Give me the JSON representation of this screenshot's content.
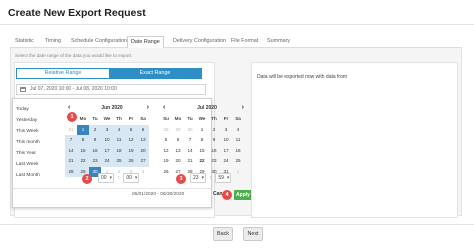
{
  "dialog": {
    "title": "Create New Export Request"
  },
  "tabs": [
    {
      "label": "Statistic"
    },
    {
      "label": "Timing"
    },
    {
      "label": "Schedule Configuration"
    },
    {
      "label": "Date Range"
    },
    {
      "label": "Delivery Configuration"
    },
    {
      "label": "File Format"
    },
    {
      "label": "Summary"
    }
  ],
  "active_tab": "Date Range",
  "instruction": "Select the date range of the data you would like to export.",
  "range_type": {
    "relative": "Relative Range",
    "exact": "Exact Range",
    "selected": "Exact Range"
  },
  "date_range_input": {
    "value": "Jul 07, 2020 10:00 - Jul 08, 2020 10:00",
    "icon": "calendar-icon"
  },
  "quick_ranges": [
    "Today",
    "Yesterday",
    "This Week",
    "This month",
    "This Year",
    "Last Week",
    "Last Month"
  ],
  "calendars": [
    {
      "month": "Jun 2020",
      "dow": [
        "Su",
        "Mo",
        "Tu",
        "We",
        "Th",
        "Fr",
        "Sa"
      ],
      "days": [
        "31",
        "1",
        "2",
        "3",
        "4",
        "5",
        "6",
        "7",
        "8",
        "9",
        "10",
        "11",
        "12",
        "13",
        "14",
        "15",
        "16",
        "17",
        "18",
        "19",
        "20",
        "21",
        "22",
        "23",
        "24",
        "25",
        "26",
        "27",
        "28",
        "29",
        "30",
        "1",
        "2",
        "3",
        "4"
      ],
      "prev_icon": "chevron-left-icon",
      "next_icon": "chevron-right-icon"
    },
    {
      "month": "Jul 2020",
      "dow": [
        "Su",
        "Mo",
        "Tu",
        "We",
        "Th",
        "Fr",
        "Sa"
      ],
      "days": [
        "28",
        "29",
        "30",
        "1",
        "2",
        "3",
        "4",
        "5",
        "6",
        "7",
        "8",
        "9",
        "10",
        "11",
        "12",
        "13",
        "14",
        "15",
        "16",
        "17",
        "18",
        "19",
        "20",
        "21",
        "22",
        "23",
        "24",
        "25",
        "26",
        "27",
        "28",
        "29",
        "30",
        "31",
        "1"
      ],
      "prev_icon": "chevron-left-icon",
      "next_icon": "chevron-right-icon"
    }
  ],
  "start_time": {
    "hour": "00",
    "minute": "00"
  },
  "end_time": {
    "hour": "23",
    "minute": "59"
  },
  "step_badges": [
    "1",
    "2",
    "3",
    "4"
  ],
  "footer": {
    "range": "06/01/2020 - 06/30/2020",
    "cancel": "Cancel",
    "apply": "Apply"
  },
  "info": {
    "text": "Data will be exported now with data from"
  },
  "buttons": {
    "back": "Back",
    "next": "Next"
  },
  "colors": {
    "accent": "#2e8fc7",
    "selected_day": "#3a84c0",
    "in_range": "#d8e7f4",
    "apply": "#4cae4c",
    "badge": "#e84a4a"
  }
}
